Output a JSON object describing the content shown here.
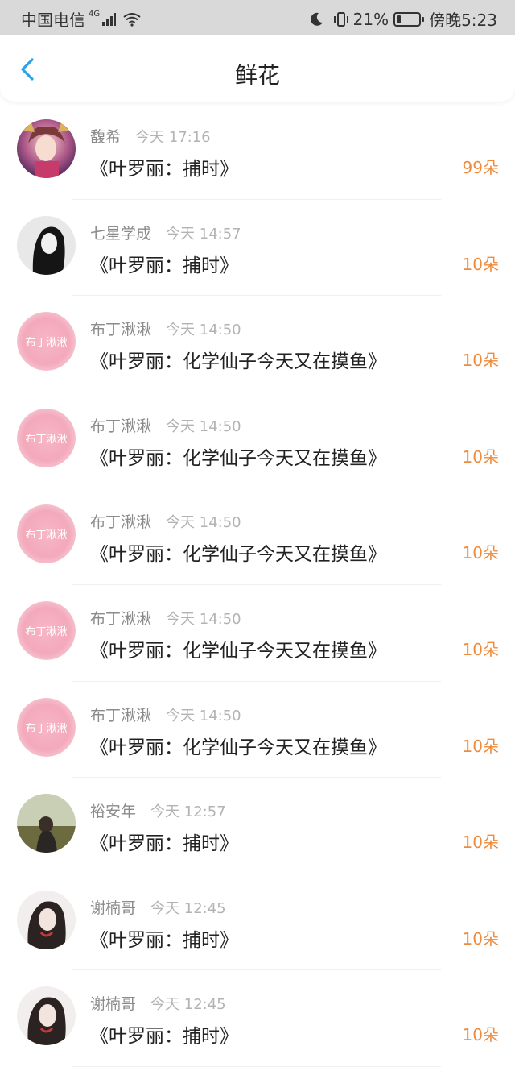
{
  "status_bar": {
    "carrier": "中国电信",
    "network": "4G",
    "battery": "21%",
    "battery_level": 0.21,
    "time": "傍晚5:23"
  },
  "header": {
    "title": "鲜花"
  },
  "rows": [
    {
      "name": "馥希",
      "time": "今天 17:16",
      "book": "《叶罗丽：捕时》",
      "count": "99朵",
      "avatar": "anime-girl"
    },
    {
      "name": "七星学成",
      "time": "今天 14:57",
      "book": "《叶罗丽：捕时》",
      "count": "10朵",
      "avatar": "bw-girl"
    },
    {
      "name": "布丁湫湫",
      "time": "今天 14:50",
      "book": "《叶罗丽：化学仙子今天又在摸鱼》",
      "count": "10朵",
      "avatar": "pink-text",
      "avatar_text": "布丁湫湫"
    },
    {
      "name": "布丁湫湫",
      "time": "今天 14:50",
      "book": "《叶罗丽：化学仙子今天又在摸鱼》",
      "count": "10朵",
      "avatar": "pink-text",
      "avatar_text": "布丁湫湫"
    },
    {
      "name": "布丁湫湫",
      "time": "今天 14:50",
      "book": "《叶罗丽：化学仙子今天又在摸鱼》",
      "count": "10朵",
      "avatar": "pink-text",
      "avatar_text": "布丁湫湫"
    },
    {
      "name": "布丁湫湫",
      "time": "今天 14:50",
      "book": "《叶罗丽：化学仙子今天又在摸鱼》",
      "count": "10朵",
      "avatar": "pink-text",
      "avatar_text": "布丁湫湫"
    },
    {
      "name": "布丁湫湫",
      "time": "今天 14:50",
      "book": "《叶罗丽：化学仙子今天又在摸鱼》",
      "count": "10朵",
      "avatar": "pink-text",
      "avatar_text": "布丁湫湫"
    },
    {
      "name": "裕安年",
      "time": "今天 12:57",
      "book": "《叶罗丽：捕时》",
      "count": "10朵",
      "avatar": "landscape-girl"
    },
    {
      "name": "谢楠哥",
      "time": "今天 12:45",
      "book": "《叶罗丽：捕时》",
      "count": "10朵",
      "avatar": "portrait-girl"
    },
    {
      "name": "谢楠哥",
      "time": "今天 12:45",
      "book": "《叶罗丽：捕时》",
      "count": "10朵",
      "avatar": "portrait-girl"
    }
  ],
  "colors": {
    "accent": "#2aa2e8",
    "count": "#ef8b3c"
  }
}
